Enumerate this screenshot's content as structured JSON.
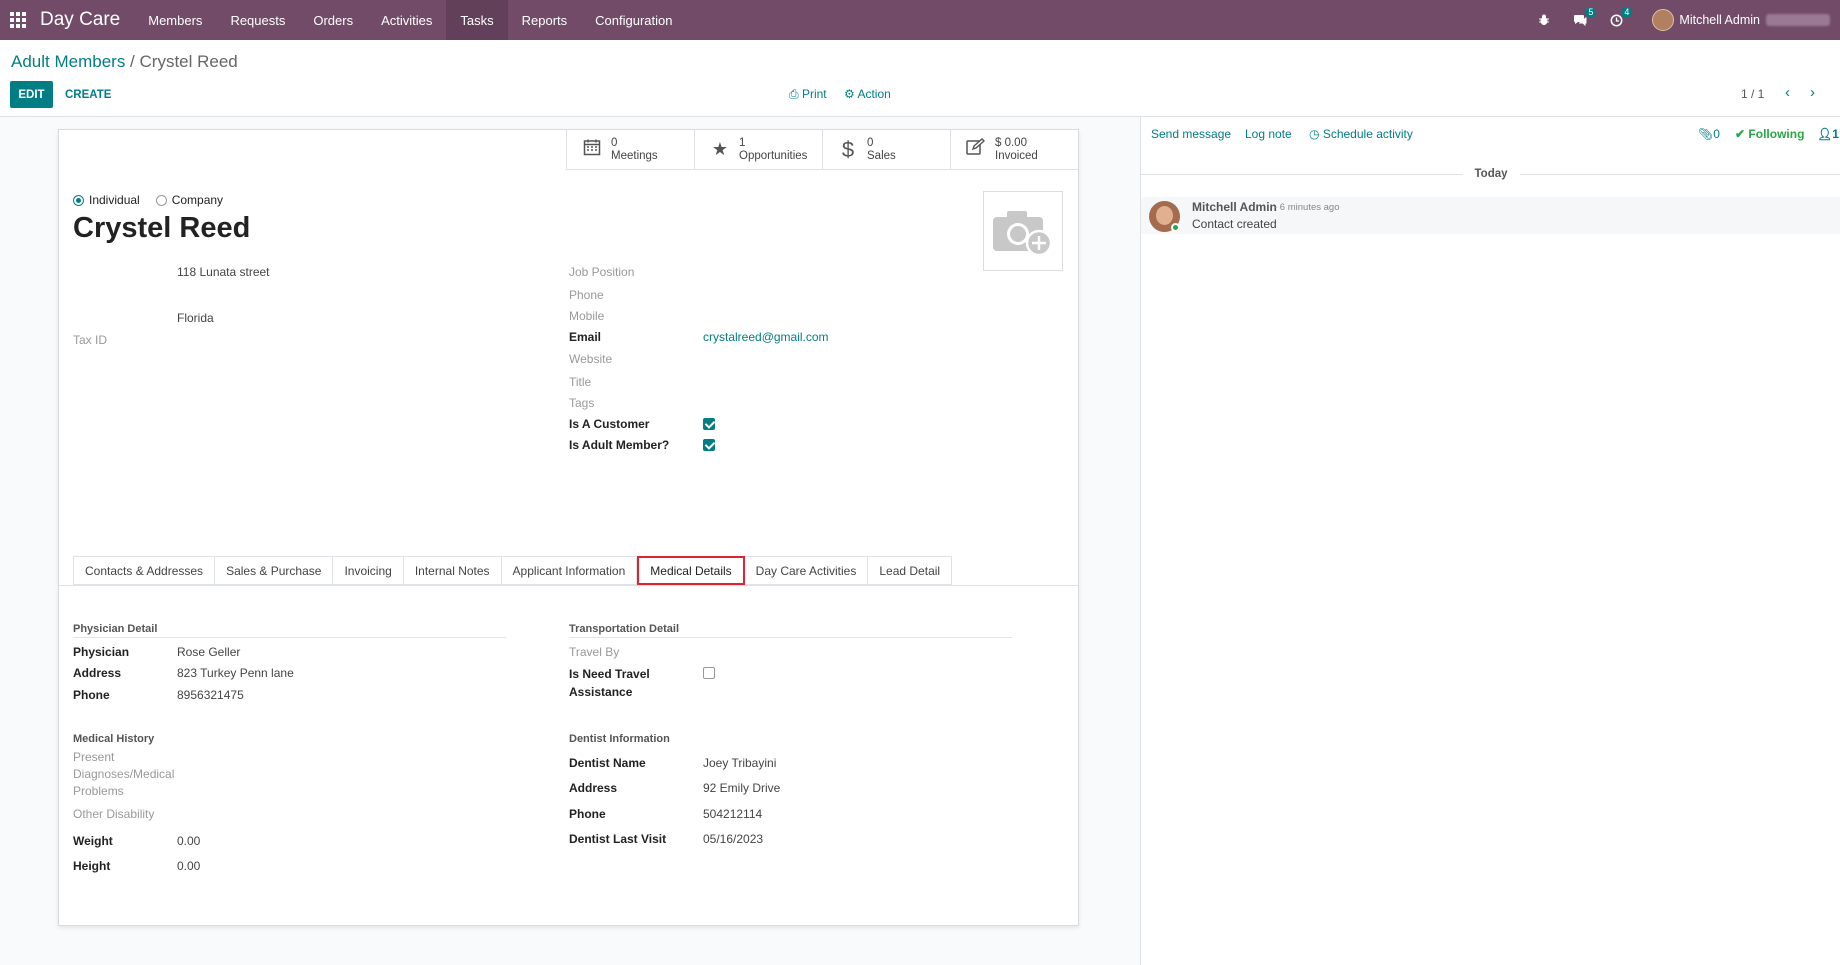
{
  "navbar": {
    "brand": "Day Care",
    "menu": [
      "Members",
      "Requests",
      "Orders",
      "Activities",
      "Tasks",
      "Reports",
      "Configuration"
    ],
    "active_menu": "Tasks",
    "messages_count": "5",
    "activities_count": "4",
    "user_name": "Mitchell Admin"
  },
  "breadcrumb": {
    "parent": "Adult Members",
    "separator": " / ",
    "current": "Crystel Reed"
  },
  "control": {
    "edit_label": "EDIT",
    "create_label": "CREATE",
    "print_label": "Print",
    "action_label": "Action",
    "pager": "1 / 1"
  },
  "stat_buttons": [
    {
      "icon": "calendar-icon",
      "value": "0",
      "label": "Meetings"
    },
    {
      "icon": "star-icon",
      "value": "1",
      "label": "Opportunities"
    },
    {
      "icon": "dollar-icon",
      "value": "0",
      "label": "Sales"
    },
    {
      "icon": "edit-icon",
      "value": "$ 0.00",
      "label": "Invoiced"
    }
  ],
  "partner": {
    "type_individual": "Individual",
    "type_company": "Company",
    "name": "Crystel Reed",
    "street": "118 Lunata street",
    "state": "Florida",
    "tax_id_label": "Tax ID"
  },
  "right_fields": {
    "job_position": "Job Position",
    "phone": "Phone",
    "mobile": "Mobile",
    "email_label": "Email",
    "email_value": "crystalreed@gmail.com",
    "website": "Website",
    "title": "Title",
    "tags": "Tags",
    "is_customer_label": "Is A Customer",
    "is_customer": true,
    "is_adult_label": "Is Adult Member?",
    "is_adult": true
  },
  "tabs": [
    "Contacts & Addresses",
    "Sales & Purchase",
    "Invoicing",
    "Internal Notes",
    "Applicant Information",
    "Medical Details",
    "Day Care Activities",
    "Lead Detail"
  ],
  "active_tab": "Medical Details",
  "medical": {
    "physician_title": "Physician Detail",
    "physician_label": "Physician",
    "physician_value": "Rose Geller",
    "address_label": "Address",
    "address_value": "823 Turkey Penn lane",
    "phone_label": "Phone",
    "phone_value": "8956321475",
    "history_title": "Medical History",
    "present_label_1": "Present",
    "present_label_2": "Diagnoses/Medical",
    "present_label_3": "Problems",
    "other_disability": "Other Disability",
    "weight_label": "Weight",
    "weight_value": "0.00",
    "height_label": "Height",
    "height_value": "0.00",
    "transport_title": "Transportation Detail",
    "travel_by": "Travel By",
    "need_travel_1": "Is Need Travel",
    "need_travel_2": "Assistance",
    "need_travel": false,
    "dentist_title": "Dentist Information",
    "dentist_name_label": "Dentist Name",
    "dentist_name_value": "Joey Tribayini",
    "dentist_address_label": "Address",
    "dentist_address_value": "92 Emily Drive",
    "dentist_phone_label": "Phone",
    "dentist_phone_value": "504212114",
    "dentist_visit_label": "Dentist Last Visit",
    "dentist_visit_value": "05/16/2023"
  },
  "chatter": {
    "send_message": "Send message",
    "log_note": "Log note",
    "schedule_activity": "Schedule activity",
    "attachments": "0",
    "following": "Following",
    "followers": "1",
    "today": "Today",
    "message": {
      "author": "Mitchell Admin",
      "time": "- 6 minutes ago",
      "body": "Contact created"
    }
  }
}
